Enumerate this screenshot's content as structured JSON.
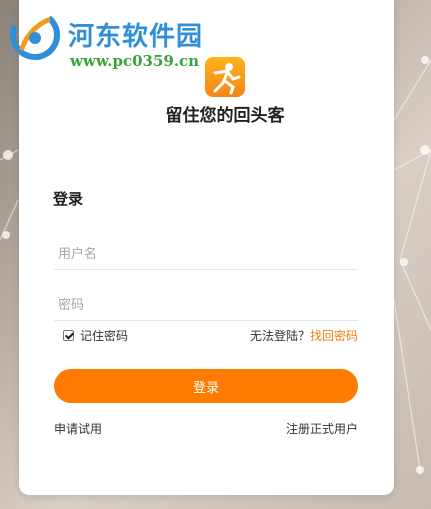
{
  "watermark": {
    "title": "河东软件园",
    "url": "www.pc0359.cn",
    "colors": {
      "title": "#2f8fd8",
      "url": "#3aa23a"
    }
  },
  "app": {
    "logo_icon": "runner-logo-icon",
    "slogan": "留住您的回头客",
    "accent": "#ff7a00"
  },
  "login": {
    "title": "登录",
    "username_placeholder": "用户名",
    "password_placeholder": "密码",
    "remember_label": "记住密码",
    "remember_checked": true,
    "cant_login_text": "无法登陆？",
    "find_password_link": "找回密码",
    "submit_label": "登录"
  },
  "footer": {
    "trial_link": "申请试用",
    "register_link": "注册正式用户"
  }
}
